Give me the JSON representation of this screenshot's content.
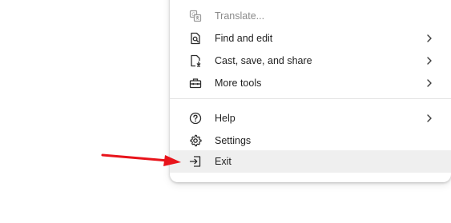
{
  "menu": {
    "items": [
      {
        "label": "Translate...",
        "icon": "translate-icon",
        "disabled": true,
        "submenu": false
      },
      {
        "label": "Find and edit",
        "icon": "find-in-page-icon",
        "disabled": false,
        "submenu": true
      },
      {
        "label": "Cast, save, and share",
        "icon": "cast-save-share-icon",
        "disabled": false,
        "submenu": true
      },
      {
        "label": "More tools",
        "icon": "toolbox-icon",
        "disabled": false,
        "submenu": true
      },
      {
        "label": "Help",
        "icon": "help-circle-icon",
        "disabled": false,
        "submenu": true
      },
      {
        "label": "Settings",
        "icon": "gear-icon",
        "disabled": false,
        "submenu": false
      },
      {
        "label": "Exit",
        "icon": "exit-icon",
        "disabled": false,
        "submenu": false,
        "highlighted": true
      }
    ]
  },
  "annotation": {
    "arrow_color": "#e8141b",
    "points_to": "Exit"
  },
  "colors": {
    "text": "#1f1f1f",
    "disabled_text": "#8a8a8a",
    "hover_background": "#efefef",
    "divider": "#e3e3e3"
  }
}
